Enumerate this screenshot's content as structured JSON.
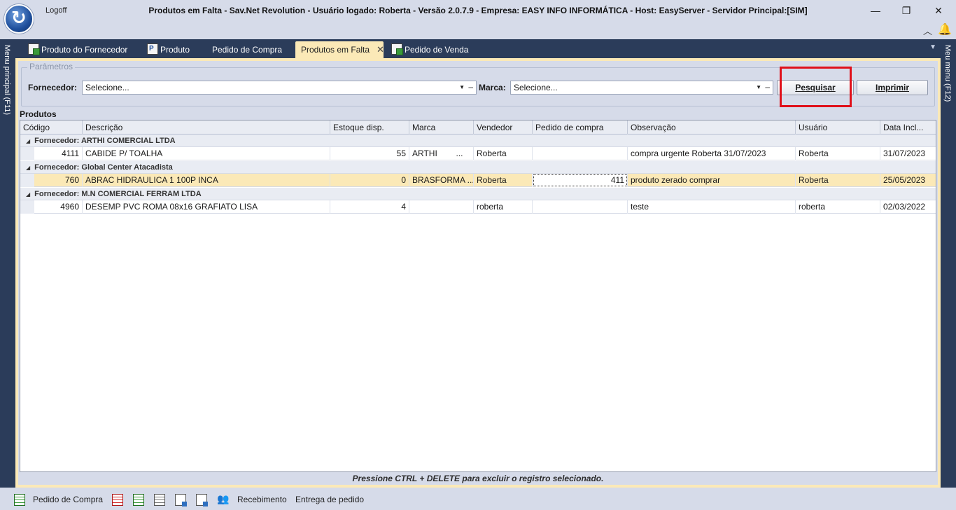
{
  "window": {
    "logoff_label": "Logoff",
    "title": "Produtos em Falta - Sav.Net Revolution - Usuário logado: Roberta - Versão 2.0.7.9 - Empresa: EASY INFO INFORMÁTICA - Host: EasyServer - Servidor Principal:[SIM]",
    "minimize_glyph": "—",
    "restore_glyph": "❐",
    "close_glyph": "✕"
  },
  "side": {
    "left_label": "Menu principal (F11)",
    "right_label": "Meu menu (F12)"
  },
  "tabs": [
    {
      "label": "Produto do Fornecedor",
      "icon": "supplier-product-icon"
    },
    {
      "label": "Produto",
      "icon": "product-icon"
    },
    {
      "label": "Pedido de Compra",
      "icon": ""
    },
    {
      "label": "Produtos em Falta",
      "icon": "",
      "active": true,
      "close": "✕"
    },
    {
      "label": "Pedido de Venda",
      "icon": "sales-order-icon"
    }
  ],
  "params": {
    "legend": "Parâmetros",
    "fornecedor_label": "Fornecedor:",
    "fornecedor_value": "Selecione...",
    "marca_label": "Marca:",
    "marca_value": "Selecione...",
    "pesquisar_label": "Pesquisar",
    "imprimir_label": "Imprimir"
  },
  "grid": {
    "title": "Produtos",
    "columns": [
      "Código",
      "Descrição",
      "Estoque disp.",
      "Marca",
      "Vendedor",
      "Pedido de compra",
      "Observação",
      "Usuário",
      "Data Incl..."
    ],
    "groups": [
      {
        "label": "Fornecedor: ARTHI COMERCIAL LTDA",
        "rows": [
          {
            "codigo": "4111",
            "descricao": "CABIDE P/  TOALHA",
            "estoque": "55",
            "marca": "ARTHI        ...",
            "vendedor": "Roberta",
            "pedido": "",
            "observacao": "compra urgente Roberta 31/07/2023",
            "usuario": "Roberta",
            "data": "31/07/2023"
          }
        ]
      },
      {
        "label": "Fornecedor: Global Center Atacadista",
        "rows": [
          {
            "codigo": "760",
            "descricao": "ABRAC HIDRAULICA 1 100P INCA",
            "estoque": "0",
            "marca": "BRASFORMA ...",
            "vendedor": "Roberta",
            "pedido": "411",
            "observacao": "produto zerado comprar",
            "usuario": "Roberta",
            "data": "25/05/2023"
          }
        ]
      },
      {
        "label": "Fornecedor: M.N COMERCIAL FERRAM LTDA",
        "rows": [
          {
            "codigo": "4960",
            "descricao": "DESEMP PVC ROMA 08x16 GRAFIATO LISA",
            "estoque": "4",
            "marca": "",
            "vendedor": "roberta",
            "pedido": "",
            "observacao": "teste",
            "usuario": "roberta",
            "data": "02/03/2022"
          }
        ]
      }
    ],
    "hint": "Pressione CTRL + DELETE para excluir o registro selecionado."
  },
  "bottombar": {
    "pedido_compra": "Pedido de Compra",
    "recebimento": "Recebimento",
    "entrega": "Entrega de pedido"
  },
  "colors": {
    "accent_tab": "#fbe9b7",
    "dark_strip": "#2b3c5a",
    "highlight_border": "#e0101a"
  }
}
